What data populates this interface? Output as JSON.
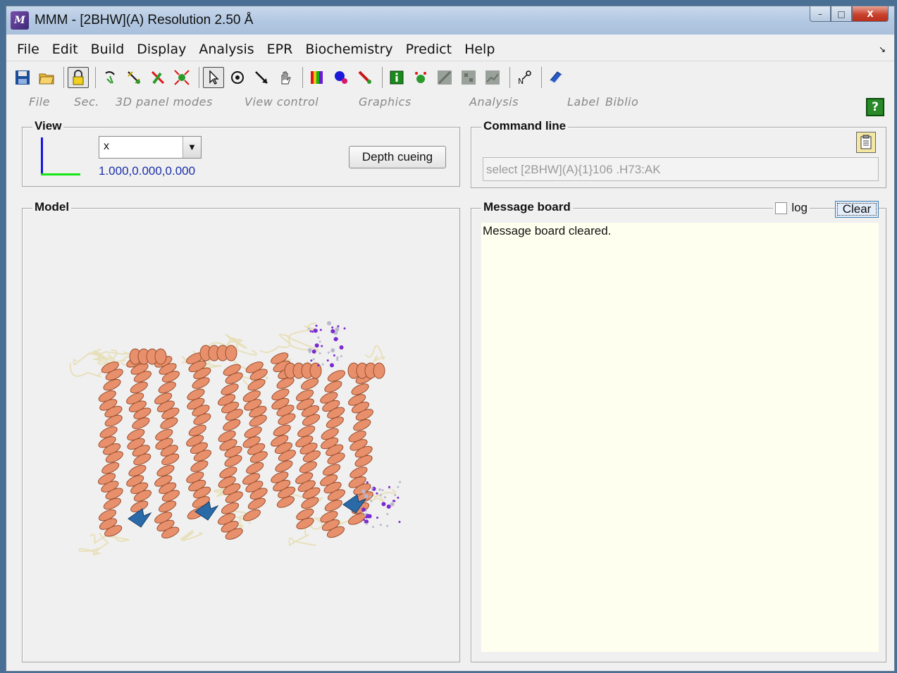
{
  "window": {
    "title": "MMM - [2BHW](A) Resolution 2.50 Å",
    "logo": "M",
    "controls": [
      "–",
      "□",
      "X"
    ]
  },
  "menu": {
    "items": [
      "File",
      "Edit",
      "Build",
      "Display",
      "Analysis",
      "EPR",
      "Biochemistry",
      "Predict",
      "Help"
    ],
    "overflow": "↘"
  },
  "toolbar": {
    "icons": [
      "save-icon",
      "open-folder-icon",
      "lock-icon",
      "rotate-icon",
      "bond-icon",
      "move-icon",
      "explode-icon",
      "pointer-icon",
      "spin-icon",
      "zoom-arrow-icon",
      "hand-icon",
      "color-spectrum-icon",
      "sphere-icon",
      "ribbon-icon",
      "info-icon",
      "residue-icon",
      "contact-map-icon",
      "network-icon",
      "graph-icon",
      "label-icon",
      "book-icon"
    ]
  },
  "groups": {
    "labels": [
      "File",
      "Sec.",
      "3D panel modes",
      "View control",
      "Graphics",
      "Analysis",
      "Label",
      "Biblio"
    ],
    "help": "?"
  },
  "view": {
    "legend": "View",
    "select_value": "x",
    "coords": "1.000,0.000,0.000",
    "depth_button": "Depth cueing",
    "axis_colors": {
      "vertical": "#1414e6",
      "horizontal": "#14e614"
    }
  },
  "command": {
    "legend": "Command line",
    "input_value": "select [2BHW](A){1}106 .H73:AK"
  },
  "model": {
    "legend": "Model",
    "colors": {
      "helix": "#e8906c",
      "sheet": "#2a6aa8",
      "coil": "#e8e0bc",
      "ligand": "#7a2ad0"
    }
  },
  "messages": {
    "legend": "Message board",
    "log_label": "log",
    "clear_button": "Clear",
    "text": "Message board cleared."
  }
}
